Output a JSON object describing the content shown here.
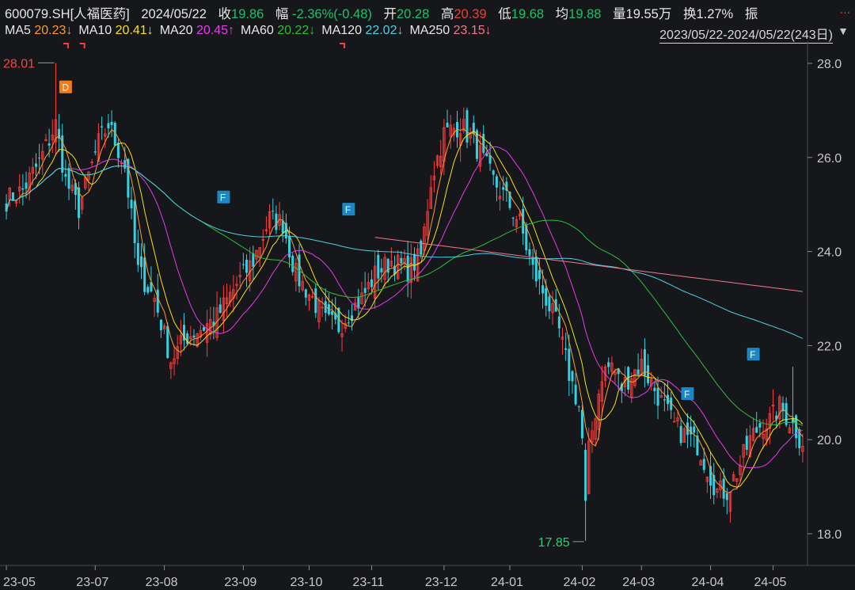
{
  "header": {
    "code": "600079.SH[人福医药]",
    "date": "2024/05/22",
    "close_label": "收",
    "close": "19.86",
    "change_label": "幅",
    "change": "-2.36%(-0.48)",
    "open_label": "开",
    "open": "20.28",
    "high_label": "高",
    "high": "20.39",
    "low_label": "低",
    "low": "19.68",
    "avg_label": "均",
    "avg": "19.88",
    "volume_label": "量",
    "volume": "19.55万",
    "turnover_label": "换",
    "turnover": "1.27%",
    "amplitude_label": "振",
    "more": "..."
  },
  "ma_legend": [
    {
      "label": "MA5",
      "value": "20.23↓",
      "color": "#e8e8e8",
      "vcolor": "#ff9a2e"
    },
    {
      "label": "MA10",
      "value": "20.41↓",
      "color": "#e8e8e8",
      "vcolor": "#f5e21b"
    },
    {
      "label": "MA20",
      "value": "20.45↑",
      "color": "#e8e8e8",
      "vcolor": "#e23ee8"
    },
    {
      "label": "MA60",
      "value": "20.22↓",
      "color": "#e8e8e8",
      "vcolor": "#2fbf3a"
    },
    {
      "label": "MA120",
      "value": "22.02↓",
      "color": "#e8e8e8",
      "vcolor": "#4fd0e0"
    },
    {
      "label": "MA250",
      "value": "23.15↓",
      "color": "#e8e8e8",
      "vcolor": "#f07b88"
    }
  ],
  "range_label": "2023/05/22-2024/05/22(243日)",
  "collapse_icon": "triangle-down",
  "chart_data": {
    "type": "candlestick",
    "y_ticks": [
      "28.0",
      "26.0",
      "24.0",
      "22.0",
      "20.0",
      "18.0"
    ],
    "ylim": [
      17.7,
      28.3
    ],
    "x_ticks": [
      {
        "label": "23-05",
        "i": 0
      },
      {
        "label": "23-07",
        "i": 27
      },
      {
        "label": "23-08",
        "i": 48
      },
      {
        "label": "23-09",
        "i": 72
      },
      {
        "label": "23-10",
        "i": 92
      },
      {
        "label": "23-11",
        "i": 111
      },
      {
        "label": "23-12",
        "i": 133
      },
      {
        "label": "24-01",
        "i": 153
      },
      {
        "label": "24-02",
        "i": 175
      },
      {
        "label": "24-03",
        "i": 193
      },
      {
        "label": "24-04",
        "i": 214
      },
      {
        "label": "24-05",
        "i": 233
      }
    ],
    "max_label": "28.01",
    "min_label": "17.85",
    "max_point": {
      "i": 15,
      "value": 28.01
    },
    "min_point": {
      "i": 176,
      "value": 17.85
    },
    "colors": {
      "up": "#ff3d3d",
      "down": "#35d1e0",
      "grid": "#2a2b30",
      "axis_text": "#c8c8c8"
    },
    "anchors": [
      [
        0,
        25.1
      ],
      [
        5,
        25.3
      ],
      [
        10,
        25.9
      ],
      [
        15,
        26.7
      ],
      [
        18,
        25.5
      ],
      [
        22,
        24.9
      ],
      [
        28,
        26.3
      ],
      [
        31,
        26.7
      ],
      [
        36,
        25.8
      ],
      [
        40,
        23.6
      ],
      [
        45,
        23.0
      ],
      [
        50,
        21.7
      ],
      [
        55,
        22.2
      ],
      [
        60,
        22.4
      ],
      [
        64,
        22.6
      ],
      [
        70,
        23.3
      ],
      [
        75,
        23.8
      ],
      [
        80,
        24.7
      ],
      [
        84,
        24.6
      ],
      [
        88,
        23.5
      ],
      [
        93,
        23.0
      ],
      [
        97,
        22.5
      ],
      [
        101,
        22.4
      ],
      [
        104,
        22.7
      ],
      [
        108,
        23.0
      ],
      [
        112,
        23.5
      ],
      [
        117,
        23.8
      ],
      [
        122,
        23.6
      ],
      [
        126,
        23.9
      ],
      [
        129,
        25.5
      ],
      [
        133,
        26.5
      ],
      [
        138,
        26.7
      ],
      [
        143,
        26.2
      ],
      [
        148,
        25.5
      ],
      [
        152,
        25.1
      ],
      [
        156,
        24.6
      ],
      [
        160,
        23.6
      ],
      [
        164,
        23.0
      ],
      [
        168,
        22.3
      ],
      [
        171,
        21.4
      ],
      [
        174,
        20.7
      ],
      [
        176,
        19.3
      ],
      [
        178,
        20.2
      ],
      [
        181,
        21.4
      ],
      [
        184,
        21.6
      ],
      [
        187,
        21.1
      ],
      [
        190,
        21.4
      ],
      [
        193,
        21.6
      ],
      [
        196,
        21.2
      ],
      [
        199,
        20.8
      ],
      [
        203,
        20.3
      ],
      [
        206,
        20.1
      ],
      [
        210,
        19.9
      ],
      [
        213,
        19.4
      ],
      [
        216,
        18.9
      ],
      [
        219,
        18.9
      ],
      [
        222,
        19.3
      ],
      [
        226,
        20.0
      ],
      [
        229,
        20.3
      ],
      [
        232,
        20.4
      ],
      [
        235,
        20.7
      ],
      [
        238,
        20.4
      ],
      [
        240,
        20.2
      ],
      [
        242,
        19.86
      ]
    ],
    "ma250_start_i": 112,
    "badges": [
      {
        "text": "D",
        "i": 18,
        "value": 27.5,
        "color": "#f07d1a"
      },
      {
        "text": "F",
        "i": 66,
        "value": 25.16,
        "color": "#1b87c4"
      },
      {
        "text": "F",
        "i": 104,
        "value": 24.9,
        "color": "#1b87c4"
      },
      {
        "text": "F",
        "i": 207,
        "value": 20.98,
        "color": "#1b87c4"
      },
      {
        "text": "F",
        "i": 227,
        "value": 21.82,
        "color": "#1b87c4"
      }
    ],
    "markers_top_i": [
      18,
      23,
      102
    ]
  }
}
